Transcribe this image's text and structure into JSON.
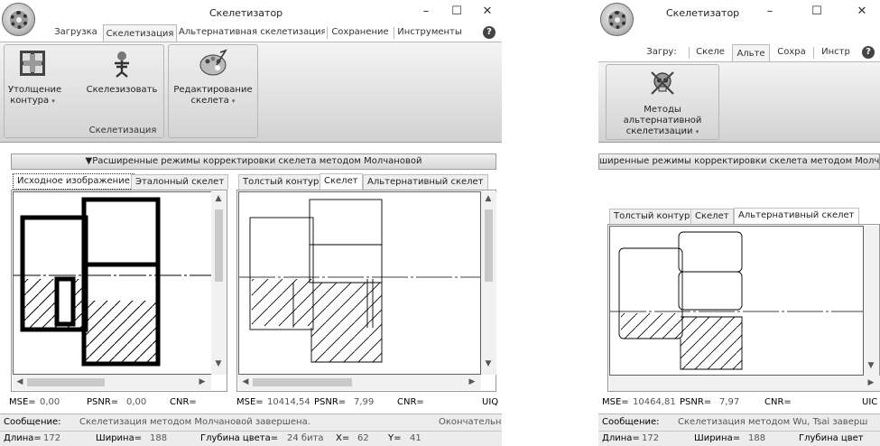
{
  "main": {
    "title": "Скелетизатор",
    "win_buttons": [
      "–",
      "☐",
      "✕"
    ],
    "tabs": [
      {
        "label": "Загрузка",
        "active": false
      },
      {
        "label": "Скелетизация",
        "active": true
      },
      {
        "label": "Альтернативная скелетизация",
        "active": false
      },
      {
        "label": "Сохранение",
        "active": false
      },
      {
        "label": "Инструменты",
        "active": false
      }
    ],
    "help_label": "?",
    "ribbon": {
      "btn_thicken": "Утолщение",
      "btn_thicken2": "контура",
      "btn_skeletonize": "Скелезизовать",
      "group_skeleton": "Скелетизация",
      "btn_edit": "Редактирование",
      "btn_edit2": "скелета",
      "caret": "▾"
    },
    "adv_bar": "▼Расширенные режимы корректировки скелета методом Молчановой",
    "left_tabs": [
      "Исходное изображение",
      "Эталонный скелет"
    ],
    "right_tabs": [
      "Толстый контур",
      "Скелет",
      "Альтернативный скелет"
    ],
    "metrics_left": {
      "mse_label": "MSE=",
      "mse": "0,00",
      "psnr_label": "PSNR=",
      "psnr": "0,00",
      "cnr_label": "CNR="
    },
    "metrics_right": {
      "mse_label": "MSE=",
      "mse": "10414,54",
      "psnr_label": "PSNR=",
      "psnr": "7,99",
      "cnr_label": "CNR=",
      "uiq_label": "UIQ"
    },
    "status": {
      "msg_label": "Сообщение:",
      "msg": "Скелетизация методом Молчановой завершена.",
      "msg_right": "Окончательн",
      "len_label": "Длина=",
      "len": "172",
      "width_label": "Ширина=",
      "width": "188",
      "depth_label": "Глубина цвета=",
      "depth": "24 бита",
      "x_label": "X=",
      "x": "62",
      "y_label": "Y=",
      "y": "41"
    }
  },
  "alt": {
    "title": "Скелетизатор",
    "win_buttons": [
      "–",
      "☐",
      "✕"
    ],
    "tabs": [
      {
        "label": "Загру:",
        "active": false
      },
      {
        "label": "Скеле",
        "active": false
      },
      {
        "label": "Альте",
        "active": true
      },
      {
        "label": "Сохра",
        "active": false
      },
      {
        "label": "Инстр",
        "active": false
      }
    ],
    "help_label": "?",
    "ribbon": {
      "btn_alt_methods": "Методы альтернативной",
      "btn_alt_methods2": "скелетизации",
      "caret": "▾"
    },
    "adv_bar": "ширенные режимы корректировки скелета методом Молч",
    "right_tabs": [
      "Толстый контур",
      "Скелет",
      "Альтернативный скелет"
    ],
    "metrics": {
      "mse_label": "MSE=",
      "mse": "10464,81",
      "psnr_label": "PSNR=",
      "psnr": "7,97",
      "cnr_label": "CNR=",
      "uiq_label": "UIC"
    },
    "status": {
      "msg_label": "Сообщение:",
      "msg": "Скелетизация методом Wu, Tsai заверш",
      "len_label": "Длина=",
      "len": "172",
      "width_label": "Ширина=",
      "width": "188",
      "depth_label": "Глубина цвет"
    }
  }
}
